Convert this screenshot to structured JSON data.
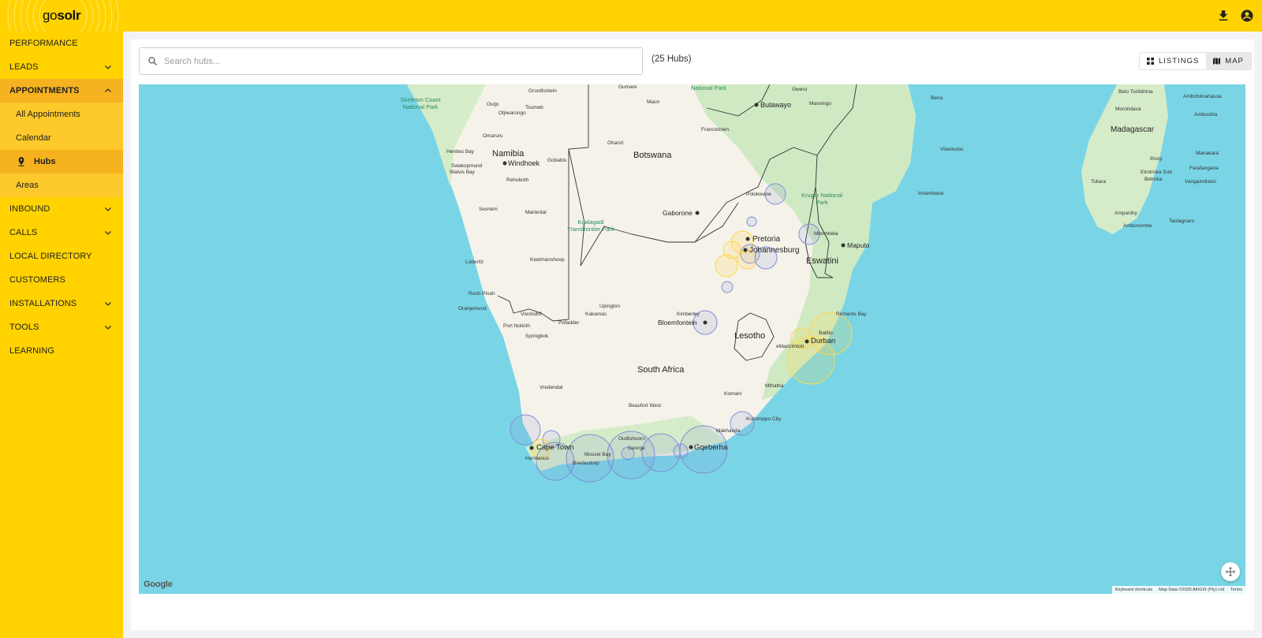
{
  "app": {
    "logo_prefix": "go",
    "logo_suffix": "solr",
    "top_icons": [
      "download-icon",
      "account-icon"
    ]
  },
  "sidebar": {
    "items": [
      {
        "label": "PERFORMANCE"
      },
      {
        "label": "LEADS",
        "expandable": true
      },
      {
        "label": "APPOINTMENTS",
        "expandable": true,
        "expanded": true
      },
      {
        "label": "INBOUND",
        "expandable": true
      },
      {
        "label": "CALLS",
        "expandable": true
      },
      {
        "label": "LOCAL DIRECTORY"
      },
      {
        "label": "CUSTOMERS"
      },
      {
        "label": "INSTALLATIONS",
        "expandable": true
      },
      {
        "label": "TOOLS",
        "expandable": true
      },
      {
        "label": "LEARNING"
      }
    ],
    "appointments_sub": [
      {
        "label": "All Appointments"
      },
      {
        "label": "Calendar"
      },
      {
        "label": "Hubs",
        "current": true,
        "icon": "map-pin-icon"
      },
      {
        "label": "Areas"
      }
    ]
  },
  "main": {
    "search_placeholder": "Search hubs...",
    "hub_count": "(25 Hubs)",
    "view_toggle": {
      "listings": "LISTINGS",
      "map": "MAP",
      "active": "map"
    }
  },
  "map": {
    "countries": [
      "Namibia",
      "Botswana",
      "South Africa",
      "Lesotho",
      "Eswatini",
      "Madagascar"
    ],
    "cities": [
      "Windhoek",
      "Gaborone",
      "Pretoria",
      "Johannesburg",
      "Bulawayo",
      "Maputo",
      "Bloemfontein",
      "Durban",
      "Cape Town",
      "Gqeberha"
    ],
    "places": [
      "Tsumeb",
      "Grootfontein",
      "Gumare",
      "Maun",
      "Gweru",
      "Masvingo",
      "Outjo",
      "Otjiwarongo",
      "Omaruru",
      "Ghanzi",
      "Henties Bay",
      "Swakopmund",
      "Walvis Bay",
      "Gobabis",
      "Rehoboth",
      "Francistown",
      "Sesriem",
      "Mariental",
      "Polokwane",
      "Lüderitz",
      "Keetmanshoop",
      "Mbombela",
      "Rosh Pinah",
      "Oranjemund",
      "Upington",
      "Vioolsdrif",
      "Port Nolloth",
      "Pofadder",
      "Kakamas",
      "Springbok",
      "Kimberley",
      "Richards Bay",
      "Ballito",
      "eManzimtoti",
      "Vredendal",
      "Mthatha",
      "Komani",
      "Beaufort West",
      "Kuzomppo City",
      "Makhanda",
      "Oudtshoorn",
      "George",
      "Mossel Bay",
      "Bredasdorp",
      "Hermanus",
      "Vilankulos",
      "Inhambane",
      "Beira",
      "Ambohimahasoa",
      "Belo Tsiribihina",
      "Morondava",
      "Ambositra",
      "Manakara",
      "Ihosy",
      "Farafangana",
      "Toliara",
      "Etrotroka Sud",
      "Betroka",
      "Vangaindrano",
      "Ampanihy",
      "Ambovombe",
      "Taolagnaro"
    ],
    "parks": [
      "Skeleton Coast National Park",
      "National Park",
      "Kgalagadi Transfrontier Park",
      "Kruger National Park"
    ],
    "google_label": "Google",
    "attribution": [
      "Keyboard shortcuts",
      "Map Data ©2026 AfriGIS (Pty) Ltd",
      "Terms"
    ],
    "colors": {
      "water": "#79d5e6",
      "land": "#f5f2ea",
      "green": "#cfe9c3",
      "circle_blue": "#7f8fd6",
      "circle_yellow": "#ffd84a"
    }
  }
}
